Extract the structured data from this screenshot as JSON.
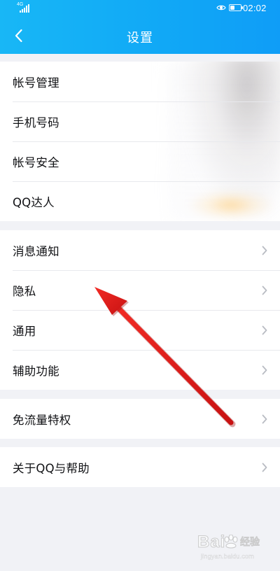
{
  "status_bar": {
    "network_label": "4G",
    "time": "02:02",
    "icons": [
      "signal-icon",
      "eye-comfort-icon",
      "battery-icon"
    ]
  },
  "header": {
    "title": "设置",
    "back_icon": "chevron-left-icon",
    "colors": {
      "start": "#18b7f6",
      "end": "#0f9df7",
      "text": "#ffffff"
    }
  },
  "sections": {
    "account": {
      "items": [
        {
          "label": "帐号管理"
        },
        {
          "label": "手机号码"
        },
        {
          "label": "帐号安全"
        },
        {
          "label": "QQ达人"
        }
      ]
    },
    "general": {
      "items": [
        {
          "label": "消息通知"
        },
        {
          "label": "隐私"
        },
        {
          "label": "通用"
        },
        {
          "label": "辅助功能"
        }
      ]
    },
    "data": {
      "items": [
        {
          "label": "免流量特权"
        }
      ]
    },
    "about": {
      "items": [
        {
          "label": "关于QQ与帮助"
        }
      ]
    }
  },
  "annotation": {
    "color": "#e01b1b",
    "points_to": "隐私"
  },
  "watermark": {
    "brand": "Bai",
    "brand_suffix": "经验",
    "url": "jingyan.baidu.com"
  },
  "theme": {
    "background": "#f1f2f6",
    "card": "#ffffff",
    "divider": "#e8e9ed",
    "chevron": "#b9bcc3"
  }
}
